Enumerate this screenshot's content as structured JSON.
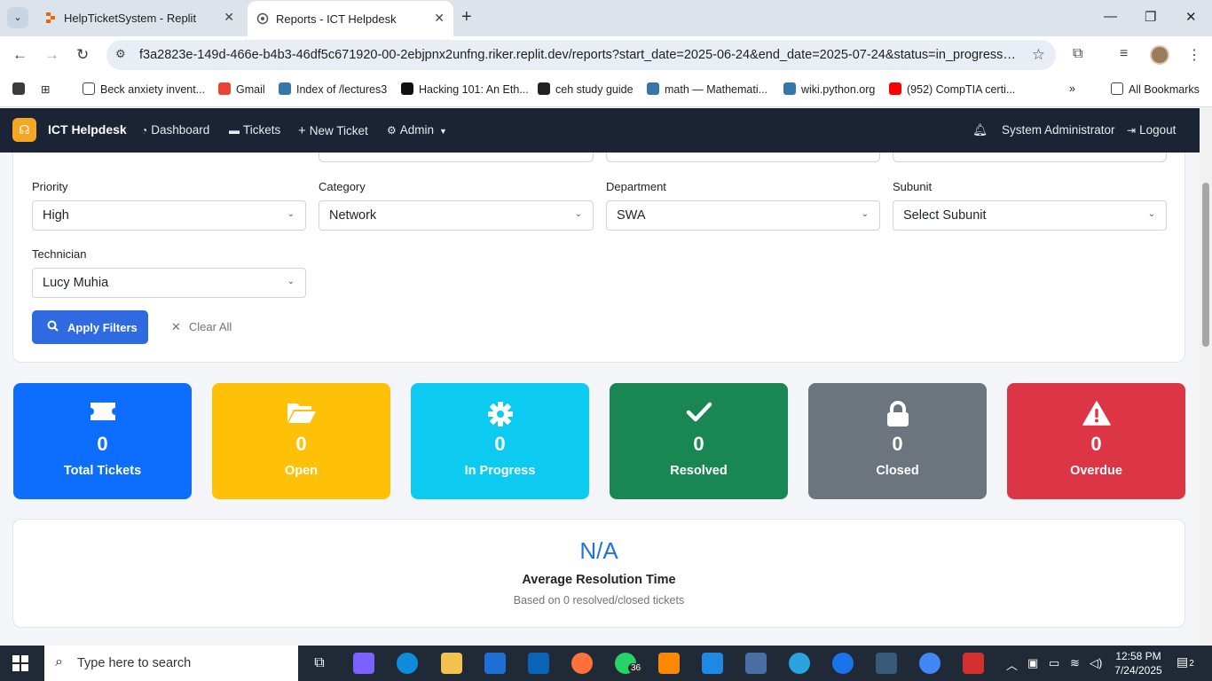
{
  "browser": {
    "tabs": [
      {
        "title": "HelpTicketSystem - Replit",
        "active": false
      },
      {
        "title": "Reports - ICT Helpdesk",
        "active": true
      }
    ],
    "url": "f3a2823e-149d-466e-b4b3-46df5c671920-00-2ebjpnx2unfng.riker.replit.dev/reports?start_date=2025-06-24&end_date=2025-07-24&status=in_progress&prio...",
    "bookmarks": [
      "Beck anxiety invent...",
      "Gmail",
      "Index of /lectures3",
      "Hacking 101: An Eth...",
      "ceh study guide",
      "math — Mathemati...",
      "wiki.python.org",
      "(952) CompTIA certi..."
    ],
    "all_bookmarks": "All Bookmarks"
  },
  "app": {
    "brand": "ICT Helpdesk",
    "nav": {
      "dashboard": "Dashboard",
      "tickets": "Tickets",
      "new_ticket": "New Ticket",
      "admin": "Admin",
      "user": "System Administrator",
      "logout": "Logout"
    }
  },
  "filters": {
    "priority": {
      "label": "Priority",
      "value": "High"
    },
    "category": {
      "label": "Category",
      "value": "Network"
    },
    "department": {
      "label": "Department",
      "value": "SWA"
    },
    "subunit": {
      "label": "Subunit",
      "value": "Select Subunit"
    },
    "technician": {
      "label": "Technician",
      "value": "Lucy Muhia"
    },
    "apply": "Apply Filters",
    "clear": "Clear All"
  },
  "stats": [
    {
      "key": "total",
      "count": "0",
      "label": "Total Tickets",
      "color": "#0d6efd",
      "icon": "ticket-icon"
    },
    {
      "key": "open",
      "count": "0",
      "label": "Open",
      "color": "#ffc107",
      "icon": "folder-open-icon"
    },
    {
      "key": "in_progress",
      "count": "0",
      "label": "In Progress",
      "color": "#0dcaf0",
      "icon": "gear-icon"
    },
    {
      "key": "resolved",
      "count": "0",
      "label": "Resolved",
      "color": "#198754",
      "icon": "check-icon"
    },
    {
      "key": "closed",
      "count": "0",
      "label": "Closed",
      "color": "#6c757d",
      "icon": "lock-icon"
    },
    {
      "key": "overdue",
      "count": "0",
      "label": "Overdue",
      "color": "#dc3545",
      "icon": "warning-icon"
    }
  ],
  "average": {
    "value": "N/A",
    "title": "Average Resolution Time",
    "note": "Based on 0 resolved/closed tickets"
  },
  "taskbar": {
    "search_placeholder": "Type here to search",
    "whatsapp_badge": "36",
    "time": "12:58 PM",
    "date": "7/24/2025",
    "notifications": "2"
  }
}
